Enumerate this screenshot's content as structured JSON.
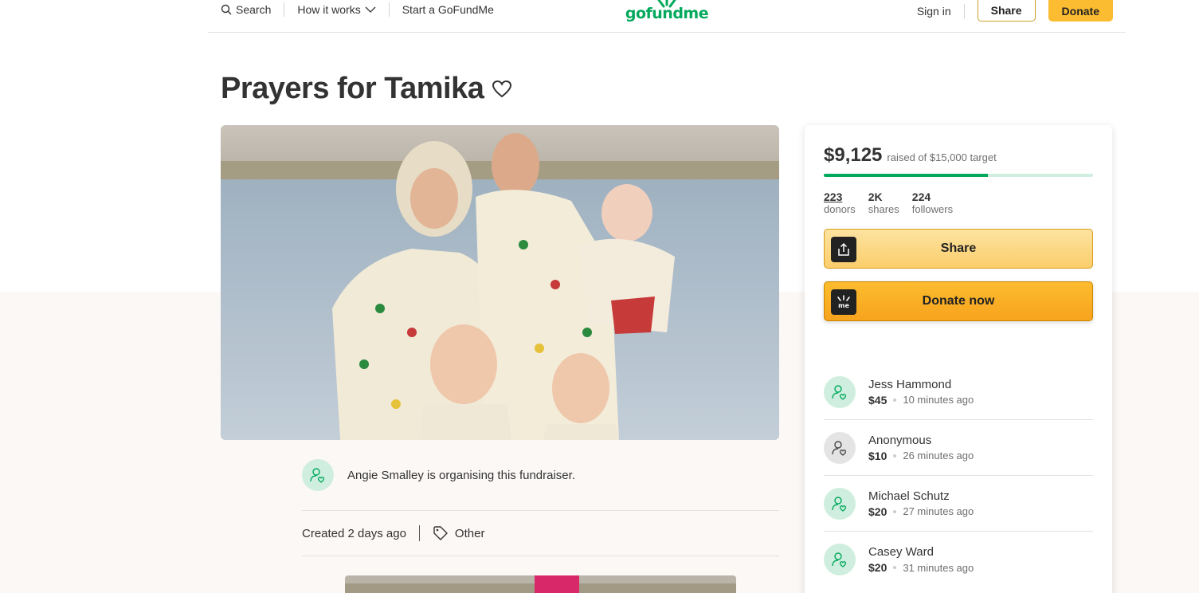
{
  "nav": {
    "search_label": "Search",
    "how_it_works_label": "How it works",
    "start_label": "Start a GoFundMe",
    "logo_text": "gofundme",
    "signin_label": "Sign in",
    "share_label": "Share",
    "donate_label": "Donate"
  },
  "campaign": {
    "title": "Prayers for Tamika",
    "organiser_text": "Angie Smalley is organising this fundraiser.",
    "created_text": "Created 2 days ago",
    "category": "Other"
  },
  "progress": {
    "raised": "$9,125",
    "target_text": "raised of $15,000 target",
    "fraction": 0.608
  },
  "stats": [
    {
      "num": "223",
      "label": "donors"
    },
    {
      "num": "2K",
      "label": "shares"
    },
    {
      "num": "224",
      "label": "followers"
    }
  ],
  "buttons": {
    "share": "Share",
    "donate_now": "Donate now",
    "donate_icon_text": "me"
  },
  "donations": [
    {
      "name": "Jess Hammond",
      "amount": "$45",
      "time": "10 minutes ago",
      "avatar": "green"
    },
    {
      "name": "Anonymous",
      "amount": "$10",
      "time": "26 minutes ago",
      "avatar": "grey"
    },
    {
      "name": "Michael Schutz",
      "amount": "$20",
      "time": "27 minutes ago",
      "avatar": "green"
    },
    {
      "name": "Casey Ward",
      "amount": "$20",
      "time": "31 minutes ago",
      "avatar": "green"
    }
  ],
  "colors": {
    "brand_green": "#02a95c",
    "donate_yellow": "#fbbc31",
    "light_green": "#cfeee0"
  }
}
